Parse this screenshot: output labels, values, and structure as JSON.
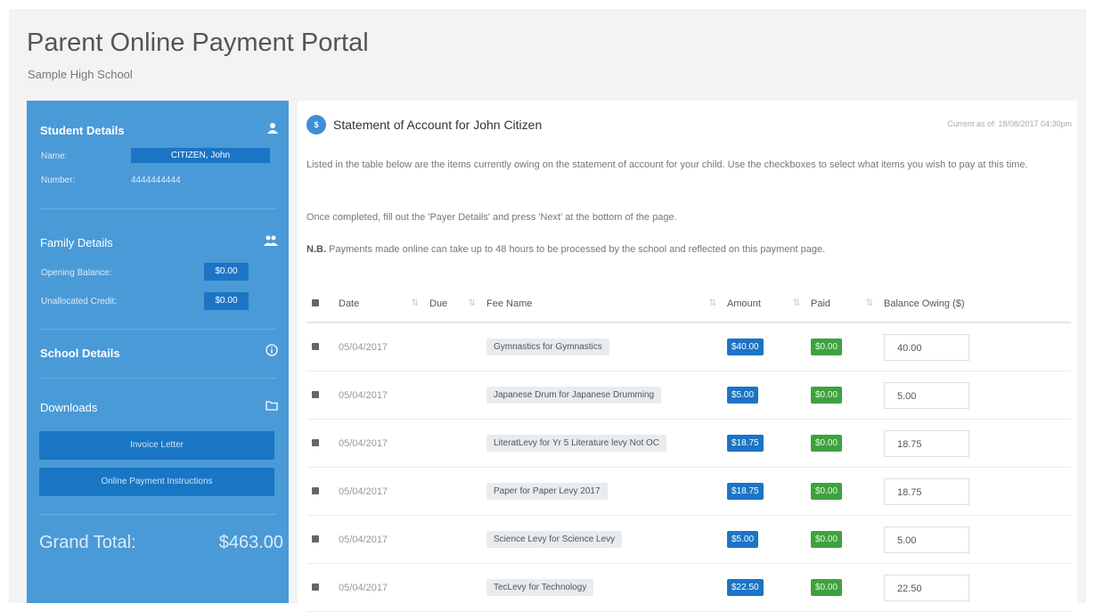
{
  "header": {
    "title": "Parent Online Payment Portal",
    "school": "Sample High School"
  },
  "sidebar": {
    "student": {
      "heading": "Student Details",
      "name_label": "Name:",
      "name_value": "CITIZEN, John",
      "number_label": "Number:",
      "number_value": "4444444444"
    },
    "family": {
      "heading": "Family Details",
      "opening_label": "Opening Balance:",
      "opening_value": "$0.00",
      "unallocated_label": "Unallocated Credit:",
      "unallocated_value": "$0.00"
    },
    "school": {
      "heading": "School Details"
    },
    "downloads": {
      "heading": "Downloads",
      "invoice_button": "Invoice Letter",
      "instructions_button": "Online Payment Instructions"
    },
    "grand_total_label": "Grand Total:",
    "grand_total_value": "$463.00"
  },
  "main": {
    "icon_text": "$",
    "title": "Statement of Account for John Citizen",
    "current_as_of": "Current as of: 18/08/2017 04:30pm",
    "para1": "Listed in the table below are the items currently owing on the statement of account for your child. Use the checkboxes to select what items you wish to pay at this time.",
    "para2": "Once completed, fill out the 'Payer Details' and press 'Next' at the bottom of the page.",
    "nb_label": "N.B.",
    "para3": "Payments made online can take up to 48 hours to be processed by the school and reflected on this payment page.",
    "columns": {
      "date": "Date",
      "due": "Due",
      "fee_name": "Fee Name",
      "amount": "Amount",
      "paid": "Paid",
      "balance": "Balance Owing ($)"
    },
    "rows": [
      {
        "date": "05/04/2017",
        "due": "",
        "fee": "Gymnastics for Gymnastics",
        "amount": "$40.00",
        "paid": "$0.00",
        "balance": "40.00"
      },
      {
        "date": "05/04/2017",
        "due": "",
        "fee": "Japanese Drum for Japanese Drumming",
        "amount": "$5.00",
        "paid": "$0.00",
        "balance": "5.00"
      },
      {
        "date": "05/04/2017",
        "due": "",
        "fee": "LiteratLevy for Yr 5 Literature levy Not OC",
        "amount": "$18.75",
        "paid": "$0.00",
        "balance": "18.75"
      },
      {
        "date": "05/04/2017",
        "due": "",
        "fee": "Paper for Paper Levy 2017",
        "amount": "$18.75",
        "paid": "$0.00",
        "balance": "18.75"
      },
      {
        "date": "05/04/2017",
        "due": "",
        "fee": "Science Levy for Science Levy",
        "amount": "$5.00",
        "paid": "$0.00",
        "balance": "5.00"
      },
      {
        "date": "05/04/2017",
        "due": "",
        "fee": "TecLevy for Technology",
        "amount": "$22.50",
        "paid": "$0.00",
        "balance": "22.50"
      }
    ]
  },
  "colors": {
    "sidebar": "#4a9ad8",
    "button": "#1976c5",
    "amount_badge": "#1c74c4",
    "paid_badge": "#3ea23f"
  }
}
